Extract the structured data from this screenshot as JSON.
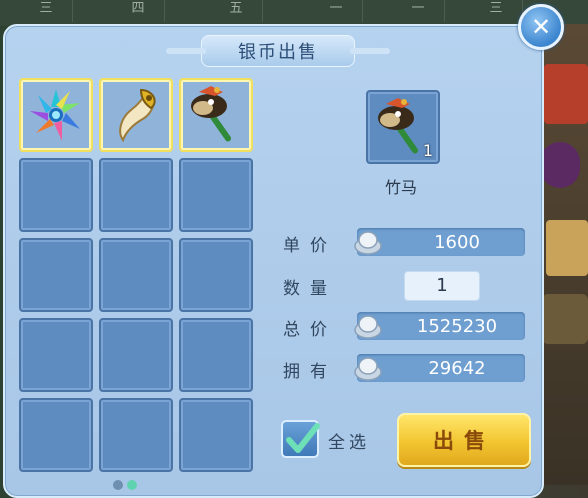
{
  "background": {
    "tabs": [
      "三",
      "四",
      "五",
      "一",
      "一",
      "三"
    ]
  },
  "dialog": {
    "title": "银币出售",
    "close_icon": "close-icon",
    "close_glyph": "✕"
  },
  "inventory": {
    "slots": [
      {
        "item": "crystal-flower-icon",
        "selected": true
      },
      {
        "item": "golden-tusk-icon",
        "selected": true
      },
      {
        "item": "bamboo-horse-icon",
        "selected": true
      },
      {
        "item": null
      },
      {
        "item": null
      },
      {
        "item": null
      },
      {
        "item": null
      },
      {
        "item": null
      },
      {
        "item": null
      },
      {
        "item": null
      },
      {
        "item": null
      },
      {
        "item": null
      },
      {
        "item": null
      },
      {
        "item": null
      },
      {
        "item": null
      }
    ]
  },
  "detail": {
    "item_icon": "bamboo-horse-icon",
    "count": "1",
    "name": "竹马"
  },
  "form": {
    "unit_price_label": "单价",
    "unit_price": "1600",
    "quantity_label": "数量",
    "quantity": "1",
    "total_label": "总价",
    "total": "1525230",
    "owned_label": "拥有",
    "owned": "29642",
    "currency_icon": "silver-coin-icon"
  },
  "actions": {
    "select_all_label": "全选",
    "select_all_checked": true,
    "sell_label": "出售"
  },
  "colors": {
    "panel": "#b0cdec",
    "slot": "#5f8cc0",
    "selected_border": "#f1df5e",
    "sell_button": "#f2c530"
  }
}
